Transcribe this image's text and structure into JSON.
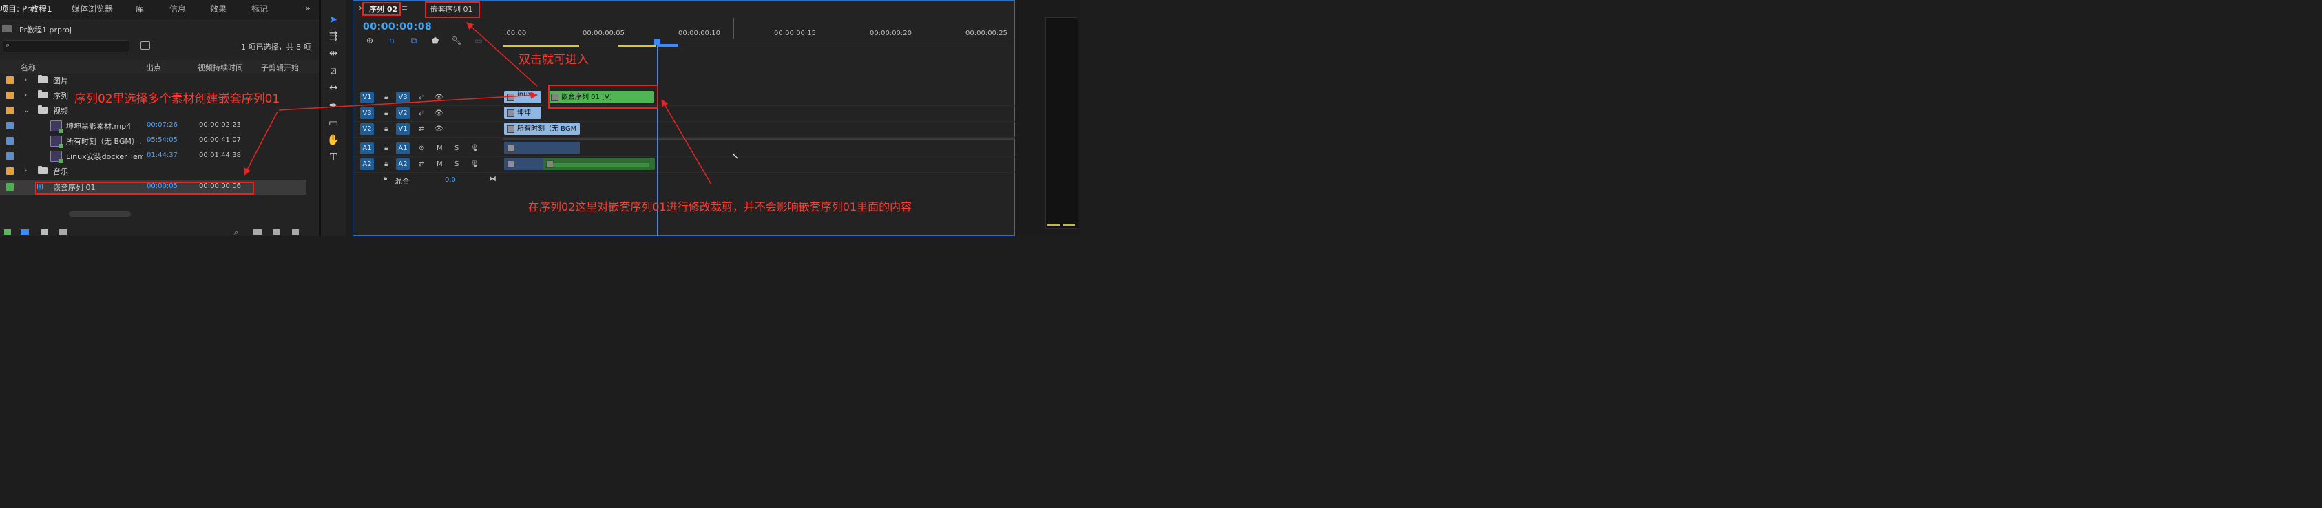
{
  "project_panel": {
    "tabs": [
      "项目: Pr教程1",
      "媒体浏览器",
      "库",
      "信息",
      "效果",
      "标记"
    ],
    "more_icon": "double-chevron-right-icon",
    "project_file": "Pr教程1.prproj",
    "search_placeholder": "",
    "item_count": "1 项已选择，共 8 项",
    "columns": [
      "名称",
      "出点",
      "视频持续时间",
      "子剪辑开始"
    ],
    "rows": [
      {
        "type": "folder",
        "name": "图片",
        "color": "#e8a13a",
        "expanded": false
      },
      {
        "type": "folder",
        "name": "序列",
        "color": "#e8a13a",
        "expanded": false
      },
      {
        "type": "folder",
        "name": "视频",
        "color": "#e8a13a",
        "expanded": true
      },
      {
        "type": "clip",
        "name": "坤坤黑影素材.mp4",
        "out": "00:07:26",
        "duration": "00:00:02:23",
        "color": "#5c8fd0"
      },
      {
        "type": "clip",
        "name": "所有时刻（无 BGM）.",
        "out": "05:54:05",
        "duration": "00:00:41:07",
        "color": "#5c8fd0"
      },
      {
        "type": "clip",
        "name": "Linux安装docker Templ",
        "out": "01:44:37",
        "duration": "00:01:44:38",
        "color": "#5c8fd0"
      },
      {
        "type": "folder",
        "name": "音乐",
        "color": "#e8a13a",
        "expanded": false
      },
      {
        "type": "sequence",
        "name": "嵌套序列 01",
        "out": "00:00:05",
        "duration": "00:00:00:06",
        "color": "#4caf50"
      }
    ]
  },
  "timeline": {
    "tabs": [
      "序列 02",
      "嵌套序列 01"
    ],
    "close_glyph": "×",
    "menu_glyph": "≡",
    "timecode": "00:00:00:08",
    "ruler_labels": [
      ":00:00",
      "00:00:00:05",
      "00:00:00:10",
      "00:00:00:15",
      "00:00:00:20",
      "00:00:00:25"
    ],
    "video_tracks": [
      {
        "src": "V1",
        "dst": "V3"
      },
      {
        "src": "V3",
        "dst": "V2"
      },
      {
        "src": "V2",
        "dst": "V1"
      }
    ],
    "audio_tracks": [
      {
        "src": "A1",
        "dst": "A1"
      },
      {
        "src": "A2",
        "dst": "A2"
      }
    ],
    "mix_label": "混合",
    "mix_value": "0.0",
    "clips": {
      "v3_linux": "inux",
      "v3_nested": "嵌套序列 01 [V]",
      "v2_kunkun": "坤坤",
      "v1_alltime": "所有时刻（无 BGM"
    }
  },
  "annotations": {
    "create_nested": "序列02里选择多个素材创建嵌套序列01",
    "double_click": "双击就可进入",
    "edit_note": "在序列02这里对嵌套序列01进行修改裁剪，并不会影响嵌套序列01里面的内容",
    "color": "#ff3b30"
  }
}
